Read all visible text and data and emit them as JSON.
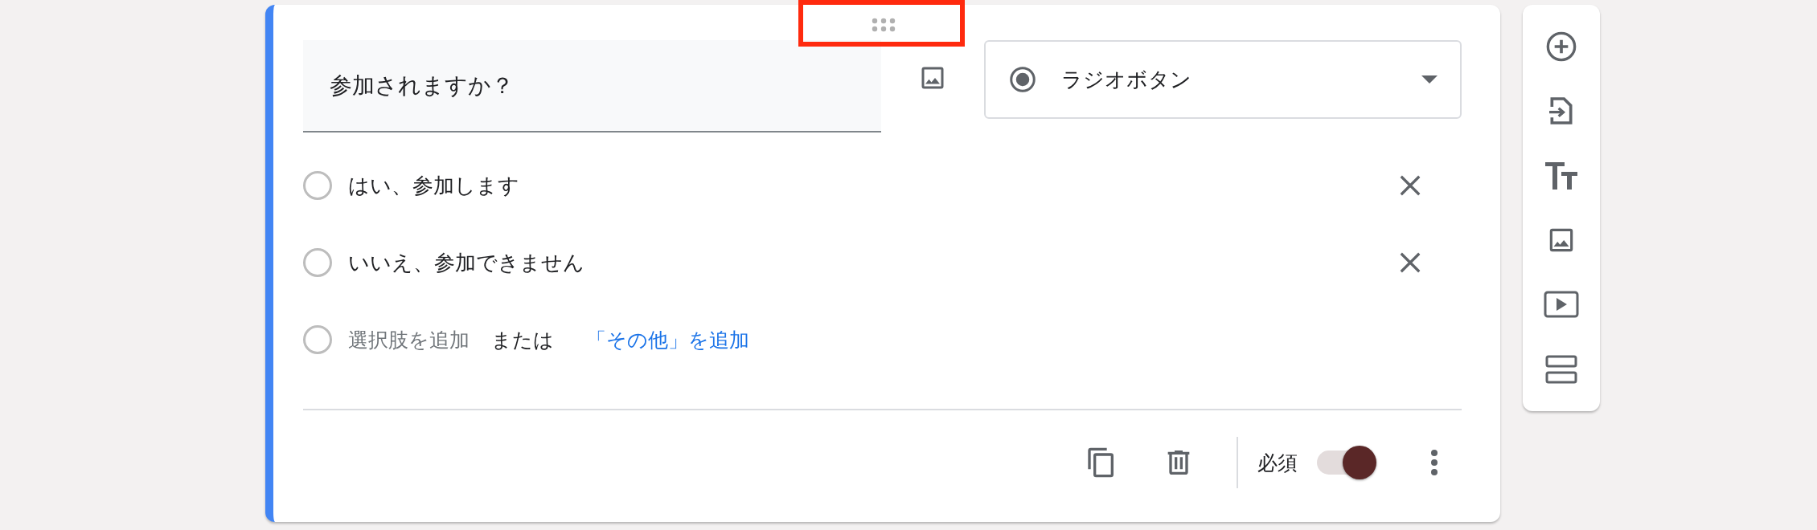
{
  "question": {
    "value": "参加されますか？"
  },
  "type_select": {
    "label": "ラジオボタン"
  },
  "options": [
    {
      "label": "はい、参加します"
    },
    {
      "label": "いいえ、参加できません"
    }
  ],
  "add_option": {
    "placeholder": "選択肢を追加",
    "separator": "または",
    "other_link": "「その他」を追加"
  },
  "footer": {
    "required_label": "必須",
    "required": true
  }
}
